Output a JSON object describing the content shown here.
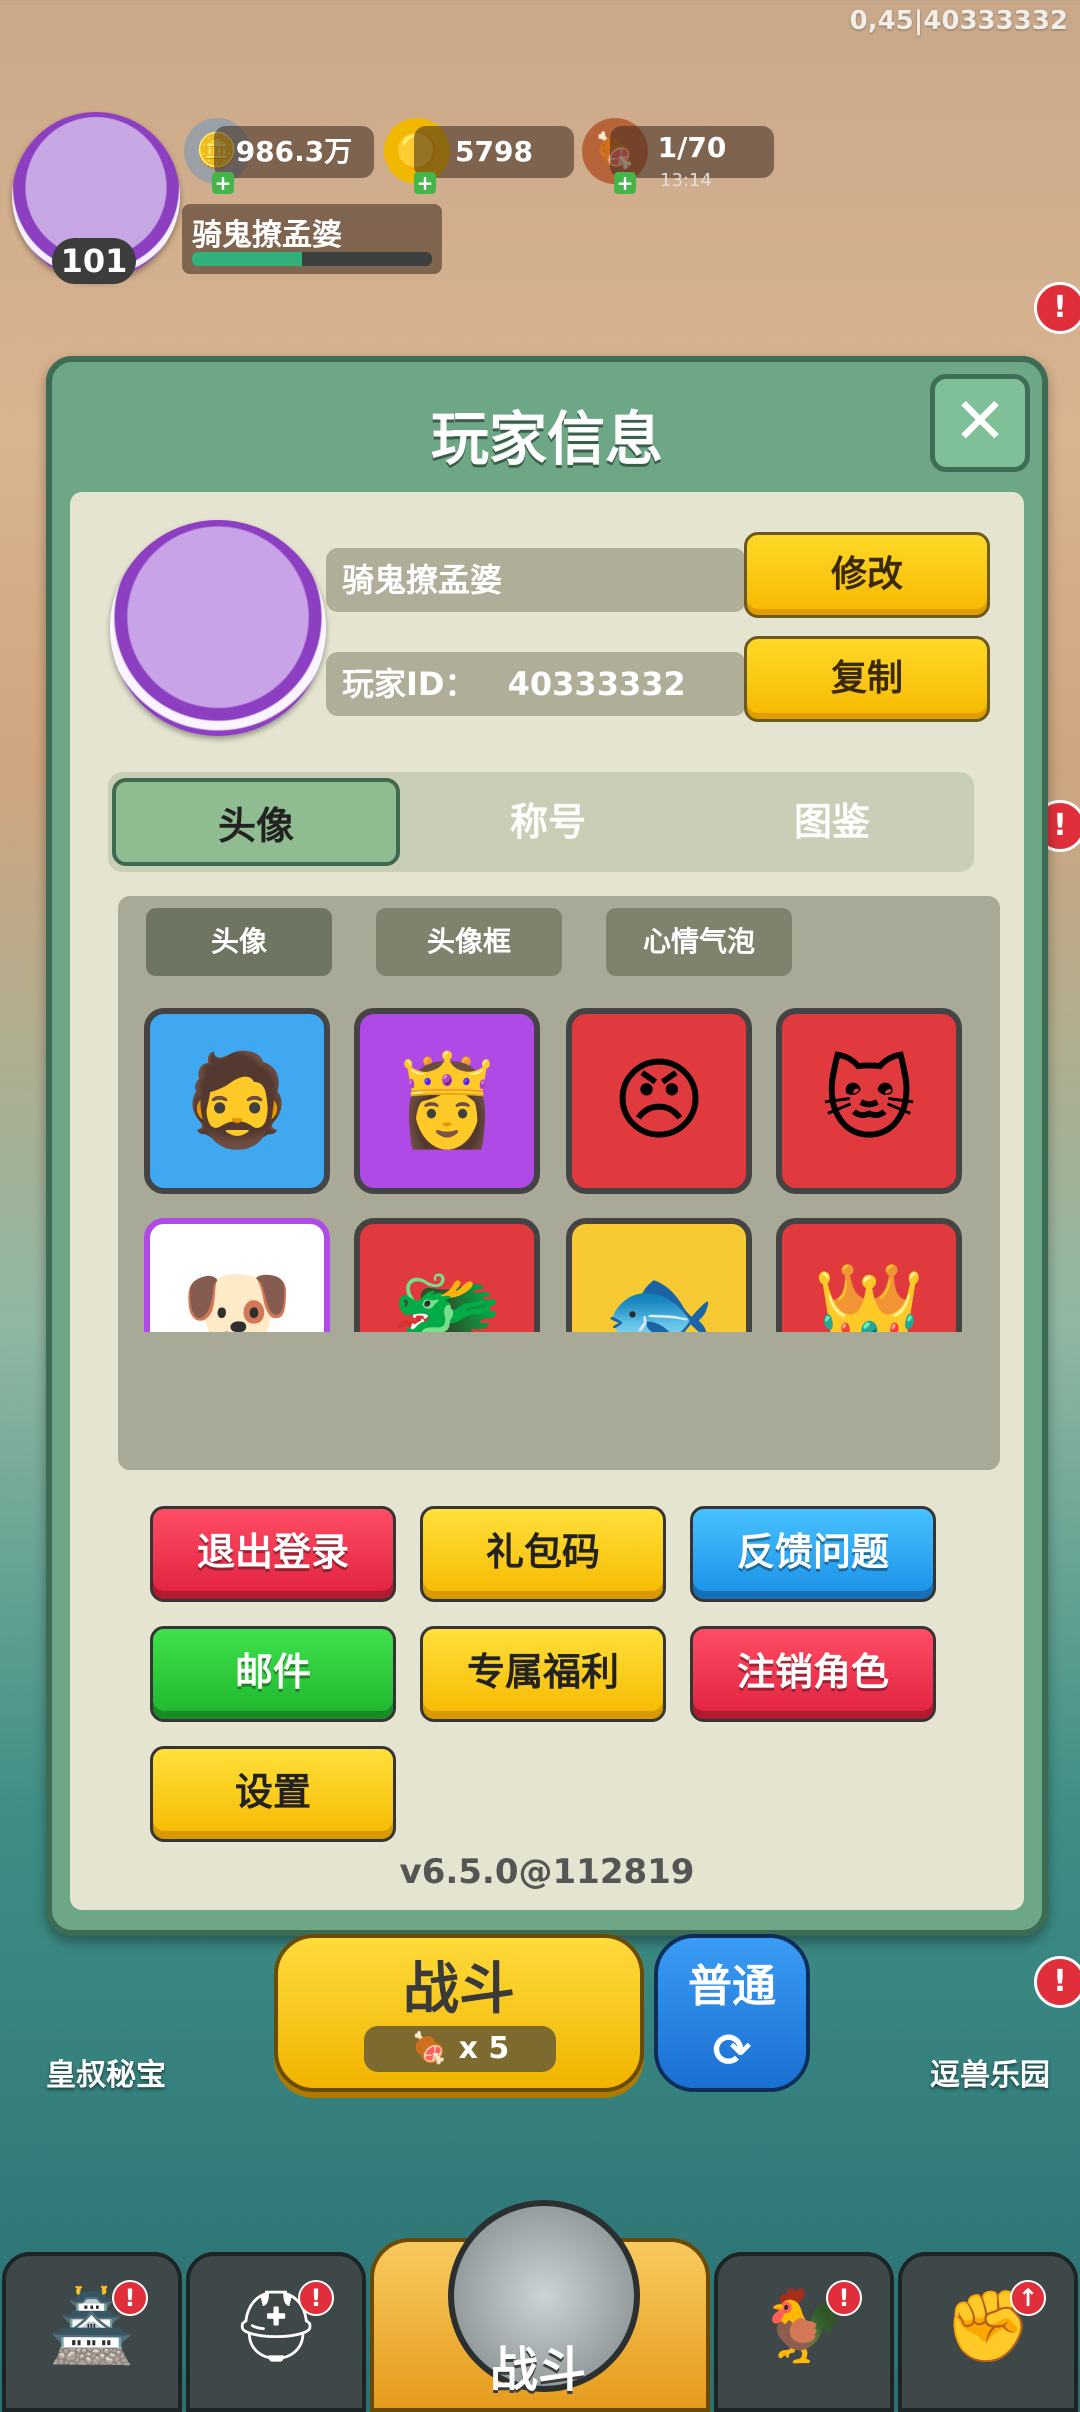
{
  "debug": "0,45|40333332",
  "topbar": {
    "level": "101",
    "silver": "986.3万",
    "gold": "5798",
    "stamina": "1/70",
    "stamina_timer": "13:14",
    "player_name": "骑鬼撩孟婆",
    "exp_percent": 46
  },
  "modal": {
    "title": "玩家信息",
    "close_glyph": "✕",
    "name_value": "骑鬼撩孟婆",
    "modify_label": "修改",
    "id_label": "玩家ID：",
    "id_value": "40333332",
    "copy_label": "复制",
    "tabs": [
      "头像",
      "称号",
      "图鉴"
    ],
    "subtabs": [
      "头像",
      "头像框",
      "心情气泡"
    ],
    "avatars": [
      {
        "emoji": "🧔",
        "color": "blue"
      },
      {
        "emoji": "👸",
        "color": "purple"
      },
      {
        "emoji": "😠",
        "color": "red"
      },
      {
        "emoji": "🐱",
        "color": "red"
      },
      {
        "emoji": "🐶",
        "color": "white"
      },
      {
        "emoji": "🐲",
        "color": "red"
      },
      {
        "emoji": "🐟",
        "color": "gold"
      },
      {
        "emoji": "👑",
        "color": "red"
      }
    ],
    "buttons": {
      "logout": "退出登录",
      "gift_code": "礼包码",
      "feedback": "反馈问题",
      "mail": "邮件",
      "welfare": "专属福利",
      "delete_role": "注销角色",
      "settings": "设置"
    },
    "version": "v6.5.0@112819"
  },
  "bottom": {
    "battle_label": "战斗",
    "battle_cost": "x 5",
    "normal_label": "普通",
    "left_shortcut": "皇叔秘宝",
    "right_shortcut": "逗兽乐园",
    "center_nav_label": "战斗"
  },
  "icons": {
    "silver": "silver-coin-icon",
    "gold": "gold-ingot-icon",
    "stamina": "meat-icon",
    "close": "close-icon",
    "refresh": "refresh-icon"
  },
  "colors": {
    "modal_green": "#6ea786",
    "button_yellow": "#f7b900",
    "button_red": "#e0213f",
    "button_blue": "#1a8fe6",
    "button_green": "#1fb52d"
  }
}
